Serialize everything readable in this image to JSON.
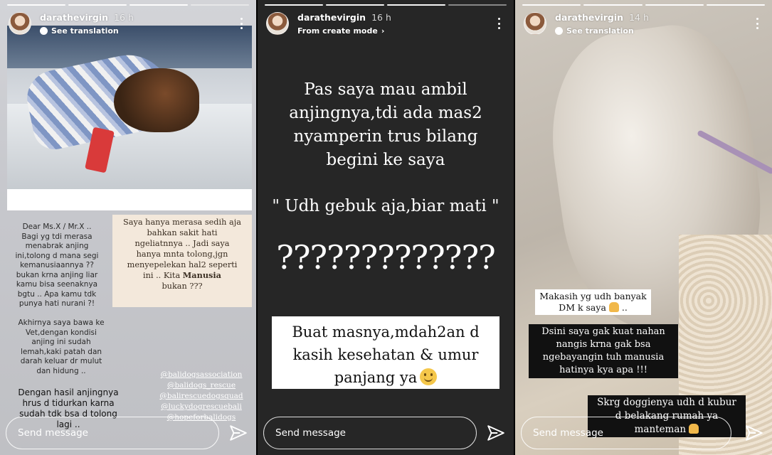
{
  "stories": [
    {
      "username": "darathevirgin",
      "time": "16 h",
      "subtitle": "See translation",
      "left_text": "Dear Ms.X / Mr.X ..\nBagi yg tdi merasa\nmenabrak anjing\nini,tolong d mana segi\nkemanusiaannya ??\nbukan krna anjing liar\nkamu bisa seenaknya\nbgtu .. Apa kamu tdk\npunya hati nurani ?!",
      "left_text_2": "Akhirnya saya bawa ke\nVet,dengan kondisi\nanjing ini sudah\nlemah,kaki patah dan\ndarah keluar dr mulut\ndan hidung ..",
      "left_text_3": "Dengan hasil anjingnya\nhrus d tidurkan karna\nsudah tdk bsa d tolong\nlagi ..",
      "note_text": "Saya hanya merasa sedih aja\nbahkan sakit hati\nngeliatnnya .. Jadi saya\nhanya mnta tolong,jgn\nmenyepelekan hal2 seperti\nini .. Kita ",
      "note_bold": "Manusia",
      "note_tail": "\nbukan ???",
      "tags": [
        "@balidogsassociation",
        "@balidogs_rescue",
        "@balirescuedogsquad",
        "@luckydogrescuebali",
        "@hopeforbalidogs"
      ],
      "send_placeholder": "Send message"
    },
    {
      "username": "darathevirgin",
      "time": "16 h",
      "subtitle": "From create mode",
      "text_1": "Pas saya mau ambil\nanjingnya,tdi ada mas2\nnyamperin trus bilang\nbegini ke saya",
      "text_2": "\" Udh gebuk aja,biar mati \"",
      "text_3": "?????????????",
      "box_text": "Buat masnya,mdah2an d\nkasih kesehatan & umur\npanjang ya",
      "send_placeholder": "Send message"
    },
    {
      "username": "darathevirgin",
      "time": "14 h",
      "subtitle": "See translation",
      "caption_1": "Makasih yg udh banyak\nDM k saya",
      "caption_1_tail": " ..",
      "caption_2": "Dsini saya gak kuat nahan\nnangis krna gak bsa\nngebayangin tuh manusia\nhatinya kya apa !!!",
      "caption_3": "Skrg doggienya udh d kubur\nd belakang rumah ya\nmanteman",
      "send_placeholder": "Send message"
    }
  ]
}
